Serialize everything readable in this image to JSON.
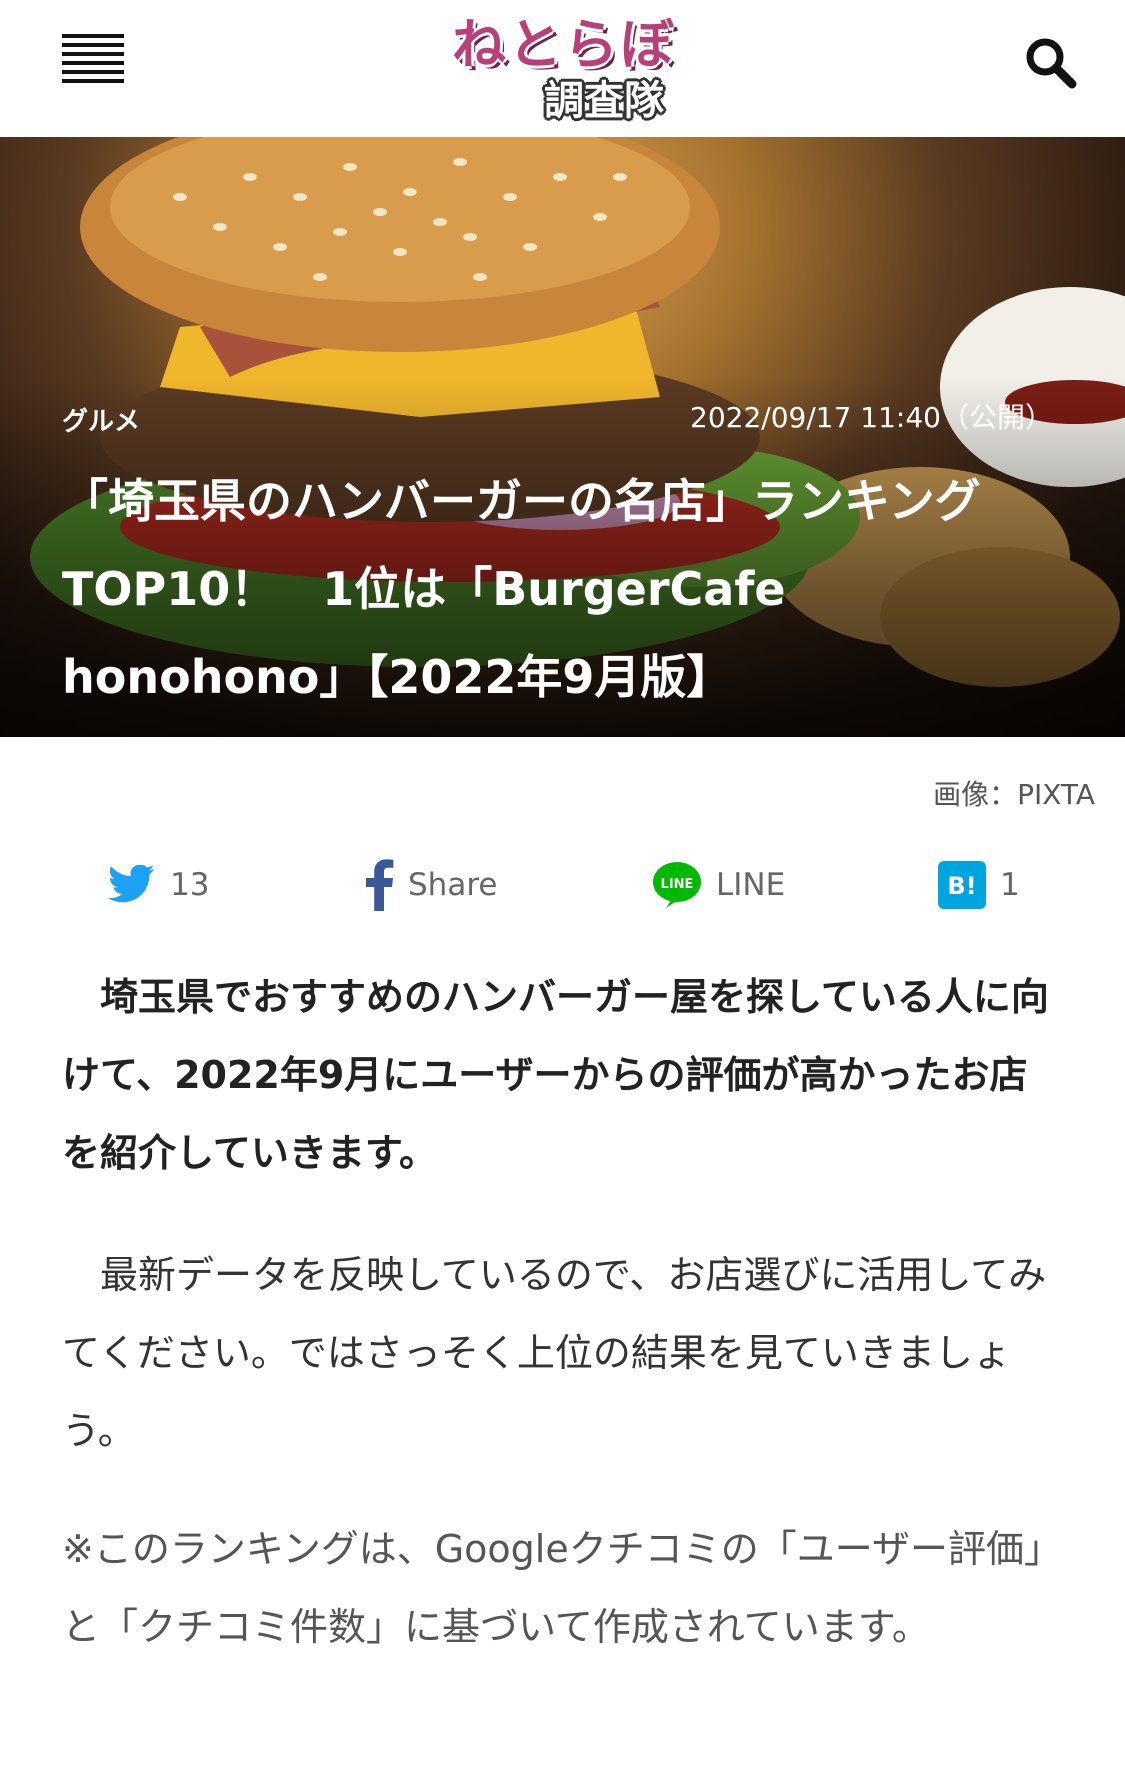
{
  "header": {
    "logo_main": "ねとらぼ",
    "logo_sub": "調査隊"
  },
  "hero": {
    "category": "グルメ",
    "date": "2022/09/17 11:40（公開）",
    "title": "「埼玉県のハンバーガーの名店」ランキングTOP10！　1位は「BurgerCafe honohono」【2022年9月版】"
  },
  "credit": "画像：PIXTA",
  "share": {
    "twitter_count": "13",
    "facebook_label": "Share",
    "line_label": "LINE",
    "hatena_count": "1"
  },
  "article": {
    "lead": "　埼玉県でおすすめのハンバーガー屋を探している人に向けて、2022年9月にユーザーからの評価が高かったお店を紹介していきます。",
    "p1": "　最新データを反映しているので、お店選びに活用してみてください。ではさっそく上位の結果を見ていきましょう。",
    "note": "※このランキングは、Googleクチコミの「ユーザー評価」と「クチコミ件数」に基づいて作成されています。"
  }
}
